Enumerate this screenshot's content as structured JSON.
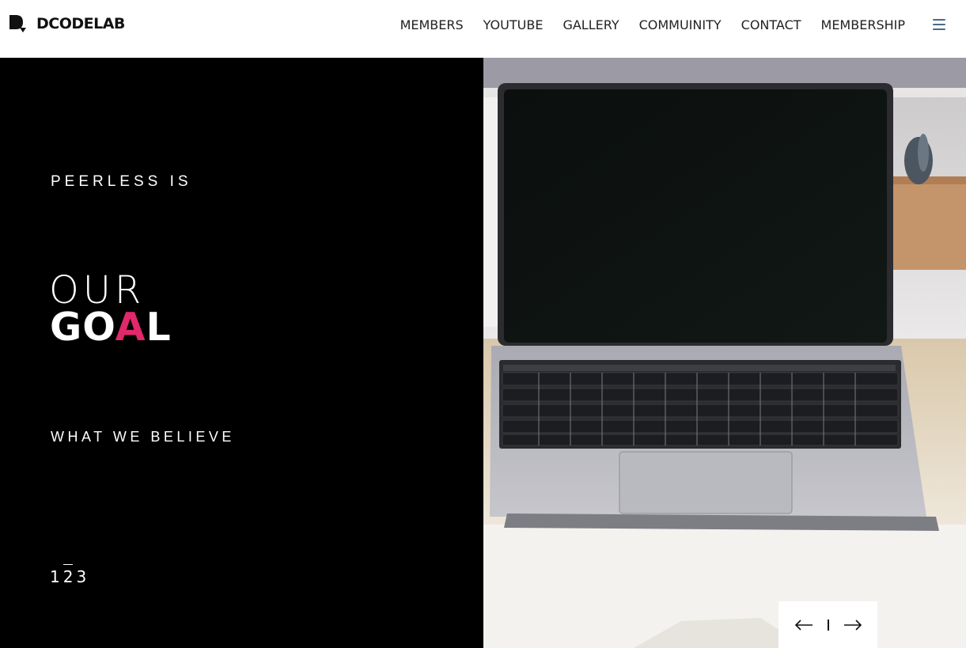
{
  "header": {
    "logo_text": "DCODELAB",
    "nav": [
      "MEMBERS",
      "YOUTUBE",
      "GALLERY",
      "COMMUINITY",
      "CONTACT",
      "MEMBERSHIP"
    ],
    "menu_icon": "hamburger-icon"
  },
  "hero": {
    "kicker": "PEERLESS IS",
    "headline_line1": "OUR",
    "headline_line2_part1": "GO",
    "headline_line2_accent": "A",
    "headline_line2_part2": "L",
    "subtitle": "WHAT WE BELIEVE",
    "pages": [
      "1",
      "2",
      "3"
    ],
    "active_page": "2",
    "accent_color": "#e0286b"
  },
  "slider": {
    "prev_icon": "arrow-left-icon",
    "next_icon": "arrow-right-icon"
  },
  "colors": {
    "left_background": "#000000",
    "header_background": "#ffffff"
  }
}
